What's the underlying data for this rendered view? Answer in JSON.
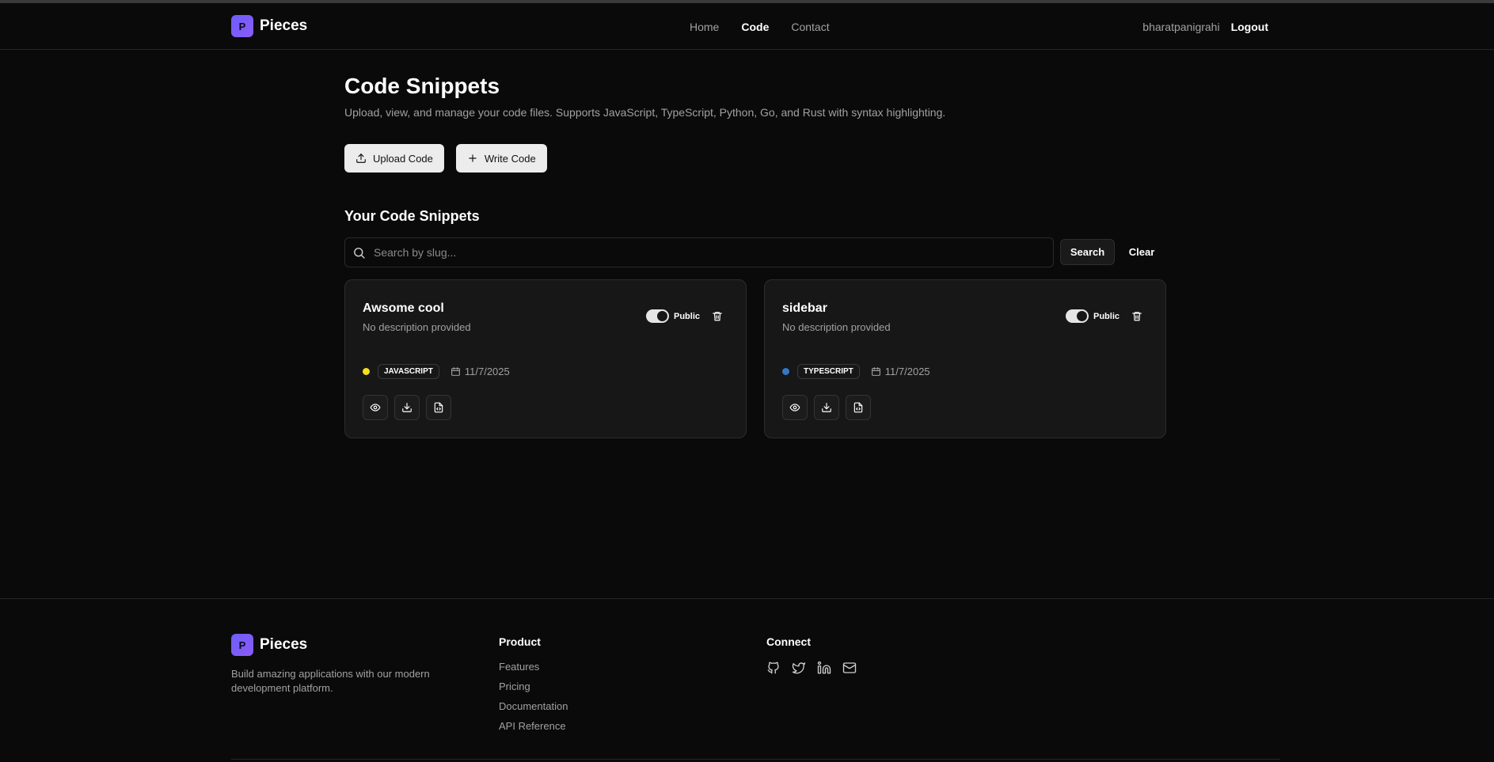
{
  "header": {
    "brand_letter": "P",
    "brand_name": "Pieces",
    "nav": [
      {
        "label": "Home",
        "active": false
      },
      {
        "label": "Code",
        "active": true
      },
      {
        "label": "Contact",
        "active": false
      }
    ],
    "username": "bharatpanigrahi",
    "logout_label": "Logout"
  },
  "main": {
    "title": "Code Snippets",
    "subtitle": "Upload, view, and manage your code files. Supports JavaScript, TypeScript, Python, Go, and Rust with syntax highlighting.",
    "upload_label": "Upload Code",
    "write_label": "Write Code",
    "section_title": "Your Code Snippets",
    "search": {
      "placeholder": "Search by slug...",
      "value": "",
      "search_label": "Search",
      "clear_label": "Clear"
    },
    "snippets": [
      {
        "title": "Awsome cool",
        "description": "No description provided",
        "visibility": "Public",
        "language": "JAVASCRIPT",
        "lang_color": "#f7df1e",
        "date": "11/7/2025"
      },
      {
        "title": "sidebar",
        "description": "No description provided",
        "visibility": "Public",
        "language": "TYPESCRIPT",
        "lang_color": "#3178c6",
        "date": "11/7/2025"
      }
    ]
  },
  "footer": {
    "brand_letter": "P",
    "brand_name": "Pieces",
    "description": "Build amazing applications with our modern development platform.",
    "product_heading": "Product",
    "product_links": [
      "Features",
      "Pricing",
      "Documentation",
      "API Reference"
    ],
    "connect_heading": "Connect",
    "social_icons": [
      "github-icon",
      "twitter-icon",
      "linkedin-icon",
      "mail-icon"
    ]
  },
  "colors": {
    "background": "#0a0a0a",
    "card": "#171717",
    "brand_gradient_start": "#6d5dfc",
    "brand_gradient_end": "#8b5cf6"
  }
}
